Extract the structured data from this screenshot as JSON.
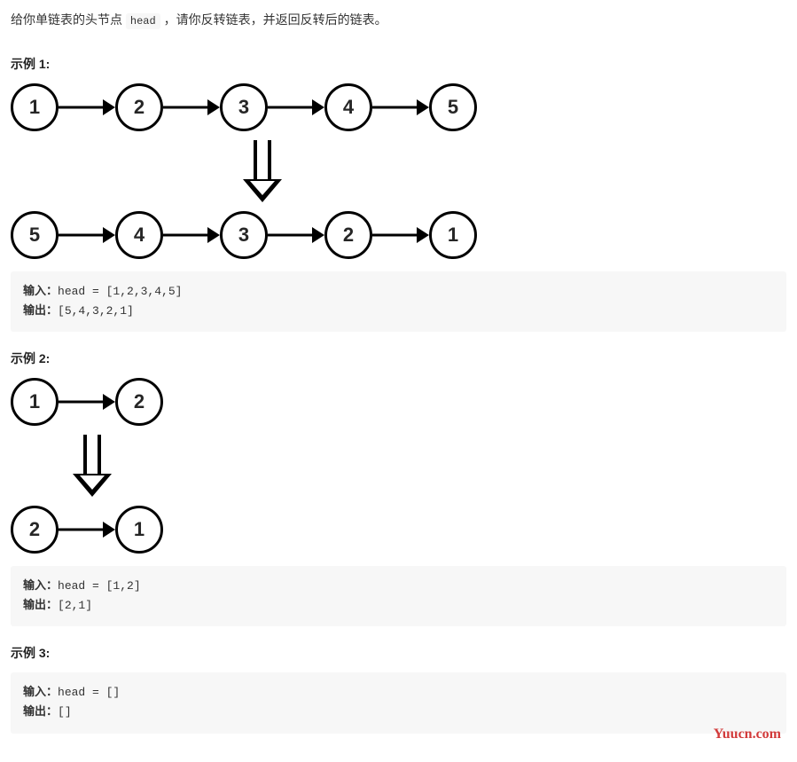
{
  "problem": {
    "prefix": "给你单链表的头节点 ",
    "code": "head",
    "suffix": " ，请你反转链表，并返回反转后的链表。"
  },
  "labels": {
    "input": "输入：",
    "output": "输出："
  },
  "examples": [
    {
      "title": "示例 1:",
      "before": [
        "1",
        "2",
        "3",
        "4",
        "5"
      ],
      "after": [
        "5",
        "4",
        "3",
        "2",
        "1"
      ],
      "input": "head = [1,2,3,4,5]",
      "output": "[5,4,3,2,1]",
      "arrowClass": ""
    },
    {
      "title": "示例 2:",
      "before": [
        "1",
        "2"
      ],
      "after": [
        "2",
        "1"
      ],
      "input": "head = [1,2]",
      "output": "[2,1]",
      "arrowClass": "short"
    },
    {
      "title": "示例 3:",
      "before": [],
      "after": [],
      "input": "head = []",
      "output": "[]",
      "arrowClass": ""
    }
  ],
  "watermark": "Yuucn.com"
}
